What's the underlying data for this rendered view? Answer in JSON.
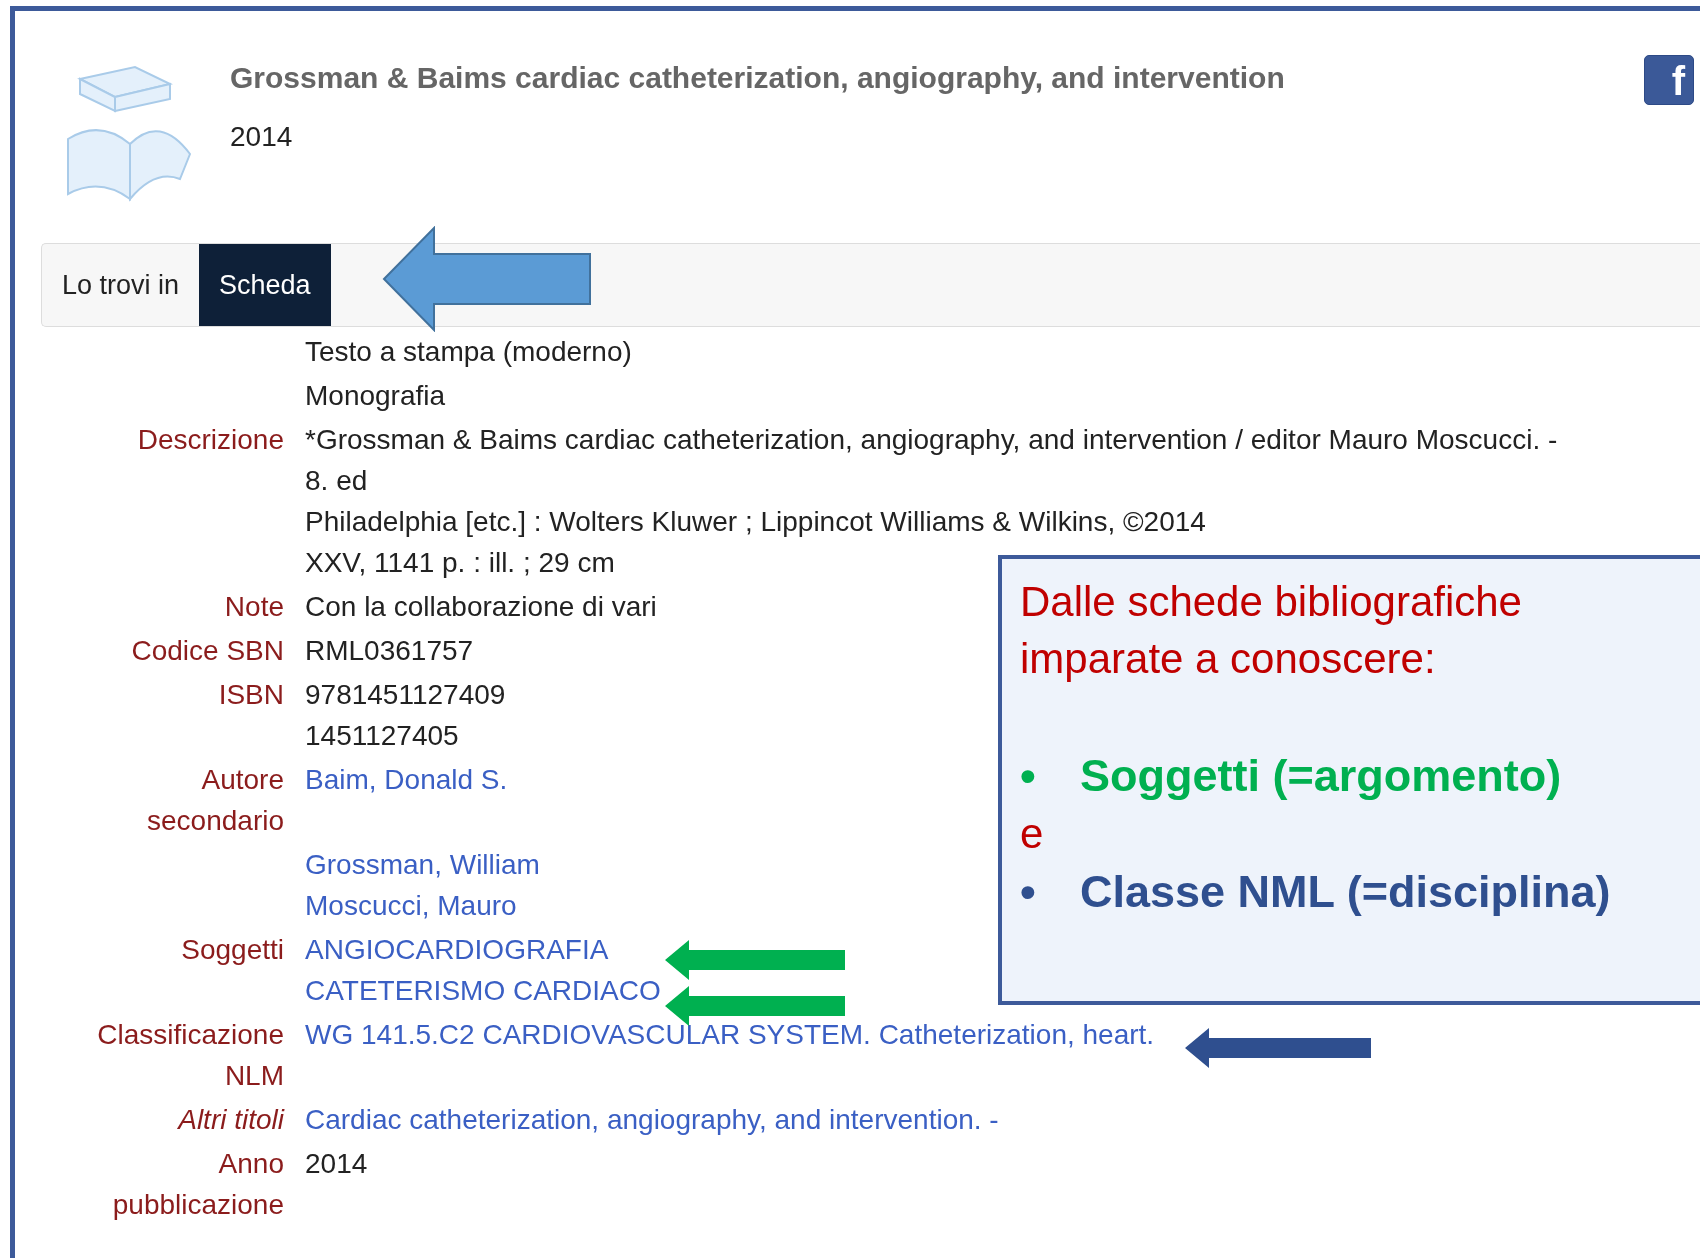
{
  "header": {
    "title": "Grossman & Baims cardiac catheterization, angiography, and intervention",
    "year": "2014",
    "share_button": "f"
  },
  "tabs": [
    {
      "label": "Lo trovi in",
      "selected": false
    },
    {
      "label": "Scheda",
      "selected": true
    }
  ],
  "record": [
    {
      "values": [
        {
          "text": "Testo a stampa (moderno)",
          "kind": "plain"
        }
      ]
    },
    {
      "values": [
        {
          "text": "Monografia",
          "kind": "plain"
        }
      ]
    },
    {
      "label": "Descrizione",
      "values": [
        {
          "text": "*Grossman & Baims cardiac catheterization, angiography, and intervention / editor Mauro Moscucci. - 8. ed",
          "kind": "plain"
        },
        {
          "text": "Philadelphia [etc.] : Wolters Kluwer ; Lippincot Williams & Wilkins, ©2014",
          "kind": "plain"
        },
        {
          "text": "XXV, 1141 p. : ill. ; 29 cm",
          "kind": "plain"
        }
      ]
    },
    {
      "label": "Note",
      "values": [
        {
          "text": "Con la collaborazione di vari",
          "kind": "plain"
        }
      ]
    },
    {
      "label": "Codice SBN",
      "values": [
        {
          "text": "RML0361757",
          "kind": "plain"
        }
      ]
    },
    {
      "label": "ISBN",
      "values": [
        {
          "text": "9781451127409",
          "kind": "plain"
        },
        {
          "text": "1451127405",
          "kind": "plain"
        }
      ]
    },
    {
      "label": "Autore secondario",
      "values": [
        {
          "text": "Baim, Donald S.",
          "kind": "link"
        }
      ]
    },
    {
      "values": [
        {
          "text": "Grossman, William",
          "kind": "link"
        },
        {
          "text": "Moscucci, Mauro",
          "kind": "link"
        }
      ]
    },
    {
      "label": "Soggetti",
      "values": [
        {
          "text": "ANGIOCARDIOGRAFIA",
          "kind": "link"
        },
        {
          "text": "CATETERISMO CARDIACO",
          "kind": "link"
        }
      ]
    },
    {
      "label": "Classificazione NLM",
      "values": [
        {
          "text": "WG 141.5.C2 CARDIOVASCULAR SYSTEM. Catheterization, heart.",
          "kind": "link"
        }
      ]
    },
    {
      "label": "Altri titoli",
      "italic": true,
      "values": [
        {
          "text": "Cardiac catheterization, angiography, and intervention. -",
          "kind": "link"
        }
      ]
    },
    {
      "label": "Anno pubblicazione",
      "values": [
        {
          "text": "2014",
          "kind": "plain"
        }
      ]
    }
  ],
  "callout": {
    "heading": "Dalle schede bibliografiche imparate a conoscere:",
    "items": [
      {
        "kind": "bullet",
        "marker": "•",
        "text": "Soggetti (=argomento)",
        "color": "#00b050"
      },
      {
        "kind": "plain",
        "text": "e"
      },
      {
        "kind": "bullet",
        "marker": "•",
        "text": "Classe NML (=disciplina)",
        "color": "#2f4f8f"
      }
    ]
  }
}
